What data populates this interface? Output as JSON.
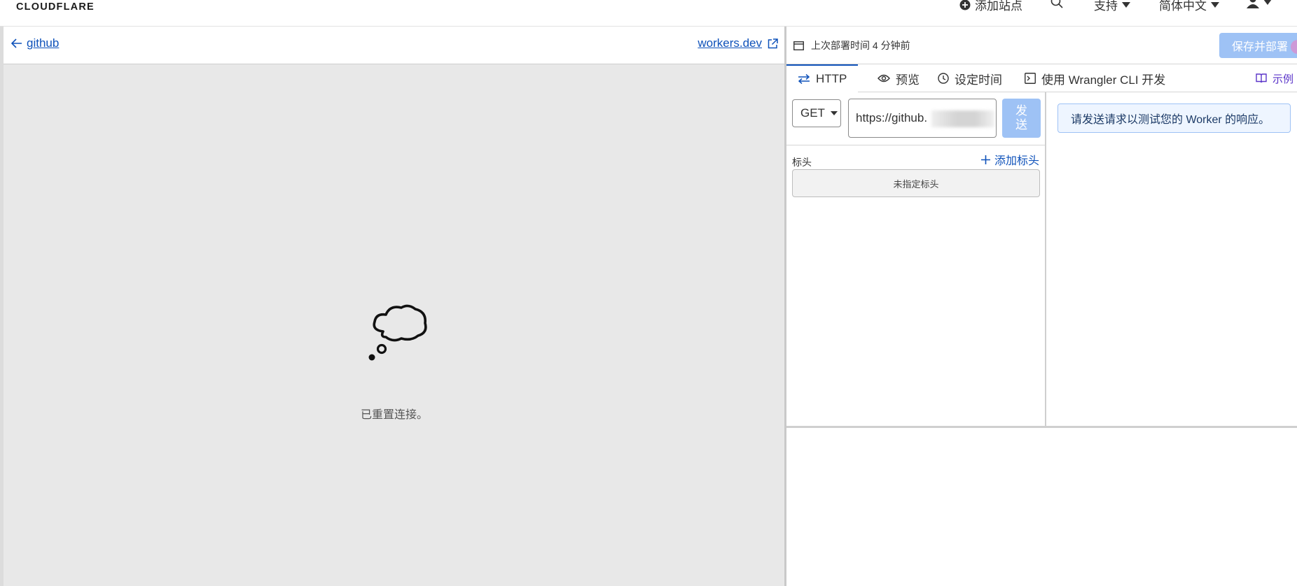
{
  "topnav": {
    "logo_text": "CLOUDFLARE",
    "add_site": "添加站点",
    "support": "支持",
    "language": "简体中文"
  },
  "left": {
    "back_label": "github",
    "workers_link": "workers.dev",
    "empty_message": "已重置连接。"
  },
  "right": {
    "deploy_time": "上次部署时间 4 分钟前",
    "save_button": "保存并部署",
    "tabs": [
      {
        "label": "HTTP",
        "icon": "arrows-exchange-icon"
      },
      {
        "label": "预览",
        "icon": "eye-icon"
      },
      {
        "label": "设定时间",
        "icon": "clock-icon"
      },
      {
        "label": "使用 Wrangler CLI 开发",
        "icon": "terminal-icon"
      }
    ],
    "examples": "示例",
    "method": "GET",
    "url": "https://github.",
    "send_line1": "发",
    "send_line2": "送",
    "headers_label": "标头",
    "add_header": "添加标头",
    "no_headers": "未指定标头",
    "response_notice": "请发送请求以测试您的 Worker 的响应。"
  },
  "colors": {
    "accent": "#0f52ba",
    "button_disabled": "#9ec2f5",
    "brand_orange": "#f38020"
  }
}
